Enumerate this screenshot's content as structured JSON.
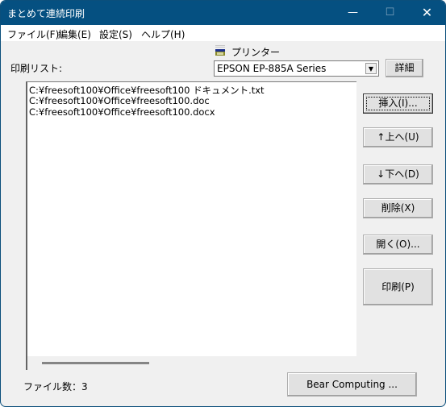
{
  "window": {
    "title": "まとめて連続印刷",
    "controls": {
      "minimize": "—",
      "maximize": "☐",
      "close": "✕"
    }
  },
  "menu": {
    "items": [
      {
        "label": "ファイル(F)"
      },
      {
        "label": "編集(E)"
      },
      {
        "label": "設定(S)"
      },
      {
        "label": "ヘルプ(H)"
      }
    ]
  },
  "print_list": {
    "label": "印刷リスト:",
    "items": [
      "C:¥freesoft100¥Office¥freesoft100 ドキュメント.txt",
      "C:¥freesoft100¥Office¥freesoft100.doc",
      "C:¥freesoft100¥Office¥freesoft100.docx"
    ]
  },
  "printer": {
    "icon": "printer-icon",
    "label": "プリンター",
    "selected": "EPSON EP-885A Series",
    "details_button": "詳細"
  },
  "buttons": {
    "insert": "挿入(I)...",
    "up": "↑上へ(U)",
    "down": "↓下へ(D)",
    "delete": "削除(X)",
    "open": "開く(O)...",
    "print": "印刷(P)",
    "about": "Bear Computing ..."
  },
  "status": {
    "file_count": "ファイル数：3"
  }
}
